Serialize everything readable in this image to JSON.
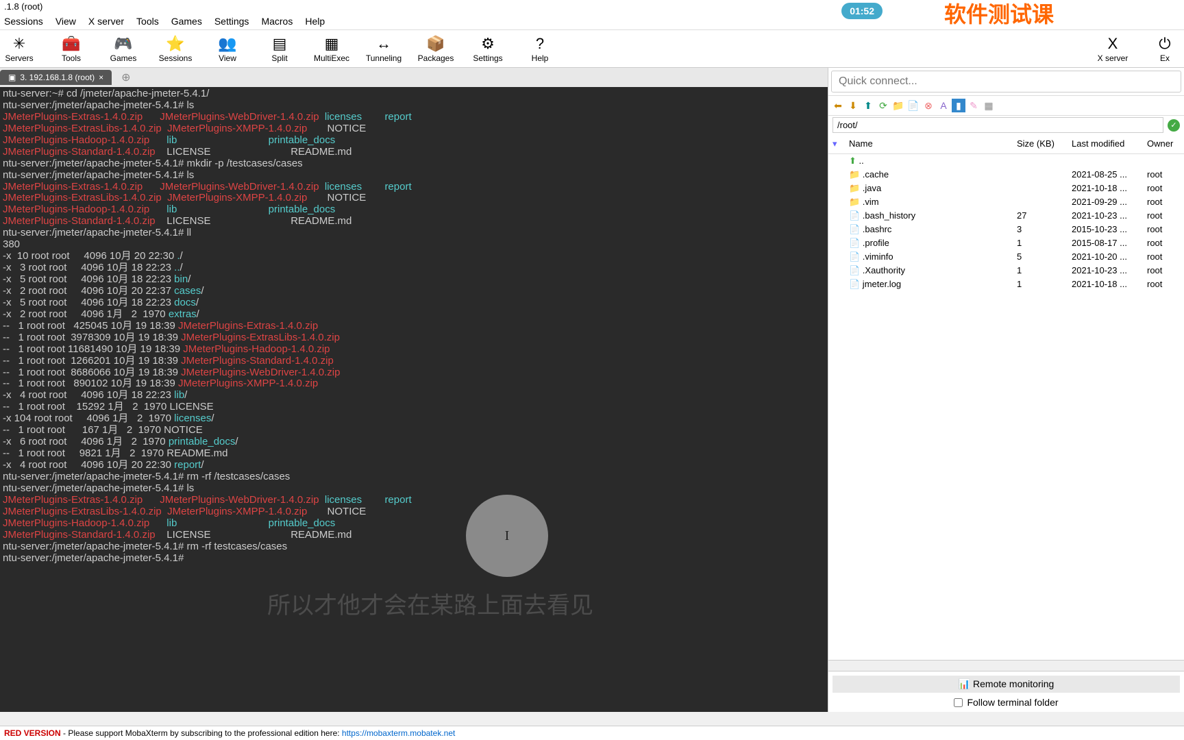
{
  "window": {
    "title": ".1.8 (root)"
  },
  "menu": [
    "Sessions",
    "View",
    "X server",
    "Tools",
    "Games",
    "Settings",
    "Macros",
    "Help"
  ],
  "toolbar": {
    "items": [
      {
        "label": "Servers",
        "icon": "✳"
      },
      {
        "label": "Tools",
        "icon": "🧰"
      },
      {
        "label": "Games",
        "icon": "🎮"
      },
      {
        "label": "Sessions",
        "icon": "⭐"
      },
      {
        "label": "View",
        "icon": "👥"
      },
      {
        "label": "Split",
        "icon": "▤"
      },
      {
        "label": "MultiExec",
        "icon": "▦"
      },
      {
        "label": "Tunneling",
        "icon": "↔"
      },
      {
        "label": "Packages",
        "icon": "📦"
      },
      {
        "label": "Settings",
        "icon": "⚙"
      },
      {
        "label": "Help",
        "icon": "?"
      }
    ],
    "right": [
      {
        "label": "X server",
        "icon": "X"
      },
      {
        "label": "Ex",
        "icon": "⏻"
      }
    ]
  },
  "tab": {
    "label": "3. 192.168.1.8 (root)"
  },
  "quick_connect": {
    "placeholder": "Quick connect..."
  },
  "path": "/root/",
  "file_columns": {
    "name": "Name",
    "size": "Size (KB)",
    "modified": "Last modified",
    "owner": "Owner"
  },
  "files": [
    {
      "name": "..",
      "size": "",
      "date": "",
      "owner": "",
      "type": "up"
    },
    {
      "name": ".cache",
      "size": "",
      "date": "2021-08-25 ...",
      "owner": "root",
      "type": "folder"
    },
    {
      "name": ".java",
      "size": "",
      "date": "2021-10-18 ...",
      "owner": "root",
      "type": "folder"
    },
    {
      "name": ".vim",
      "size": "",
      "date": "2021-09-29 ...",
      "owner": "root",
      "type": "folder"
    },
    {
      "name": ".bash_history",
      "size": "27",
      "date": "2021-10-23 ...",
      "owner": "root",
      "type": "file"
    },
    {
      "name": ".bashrc",
      "size": "3",
      "date": "2015-10-23 ...",
      "owner": "root",
      "type": "file"
    },
    {
      "name": ".profile",
      "size": "1",
      "date": "2015-08-17 ...",
      "owner": "root",
      "type": "file"
    },
    {
      "name": ".viminfo",
      "size": "5",
      "date": "2021-10-20 ...",
      "owner": "root",
      "type": "file"
    },
    {
      "name": ".Xauthority",
      "size": "1",
      "date": "2021-10-23 ...",
      "owner": "root",
      "type": "file"
    },
    {
      "name": "jmeter.log",
      "size": "1",
      "date": "2021-10-18 ...",
      "owner": "root",
      "type": "file"
    }
  ],
  "remote_monitoring": "Remote monitoring",
  "follow_terminal": "Follow terminal folder",
  "statusbar": {
    "prefix": "RED VERSION",
    "text": "  -  Please support MobaXterm by subscribing to the professional edition here:  ",
    "link": "https://mobaxterm.mobatek.net"
  },
  "timer": "01:52",
  "watermark": "软件测试课",
  "overlay": "所以才他才会在某路上面去看见",
  "terminal_lines": [
    [
      {
        "c": "white",
        "t": "ntu-server:~# cd /jmeter/apache-jmeter-5.4.1/"
      }
    ],
    [
      {
        "c": "white",
        "t": "ntu-server:/jmeter/apache-jmeter-5.4.1# ls"
      }
    ],
    [
      {
        "c": "red",
        "t": "JMeterPlugins-Extras-1.4.0.zip      "
      },
      {
        "c": "red",
        "t": "JMeterPlugins-WebDriver-1.4.0.zip  "
      },
      {
        "c": "cyan",
        "t": "licenses        "
      },
      {
        "c": "cyan",
        "t": "report"
      }
    ],
    [
      {
        "c": "red",
        "t": "JMeterPlugins-ExtrasLibs-1.4.0.zip  "
      },
      {
        "c": "red",
        "t": "JMeterPlugins-XMPP-1.4.0.zip       "
      },
      {
        "c": "white",
        "t": "NOTICE"
      }
    ],
    [
      {
        "c": "red",
        "t": "JMeterPlugins-Hadoop-1.4.0.zip      "
      },
      {
        "c": "cyan",
        "t": "lib                                "
      },
      {
        "c": "cyan",
        "t": "printable_docs"
      }
    ],
    [
      {
        "c": "red",
        "t": "JMeterPlugins-Standard-1.4.0.zip    "
      },
      {
        "c": "white",
        "t": "LICENSE                            "
      },
      {
        "c": "white",
        "t": "README.md"
      }
    ],
    [
      {
        "c": "white",
        "t": "ntu-server:/jmeter/apache-jmeter-5.4.1# mkdir -p /testcases/cases"
      }
    ],
    [
      {
        "c": "white",
        "t": "ntu-server:/jmeter/apache-jmeter-5.4.1# ls"
      }
    ],
    [
      {
        "c": "red",
        "t": "JMeterPlugins-Extras-1.4.0.zip      "
      },
      {
        "c": "red",
        "t": "JMeterPlugins-WebDriver-1.4.0.zip  "
      },
      {
        "c": "cyan",
        "t": "licenses        "
      },
      {
        "c": "cyan",
        "t": "report"
      }
    ],
    [
      {
        "c": "red",
        "t": "JMeterPlugins-ExtrasLibs-1.4.0.zip  "
      },
      {
        "c": "red",
        "t": "JMeterPlugins-XMPP-1.4.0.zip       "
      },
      {
        "c": "white",
        "t": "NOTICE"
      }
    ],
    [
      {
        "c": "red",
        "t": "JMeterPlugins-Hadoop-1.4.0.zip      "
      },
      {
        "c": "cyan",
        "t": "lib                                "
      },
      {
        "c": "cyan",
        "t": "printable_docs"
      }
    ],
    [
      {
        "c": "red",
        "t": "JMeterPlugins-Standard-1.4.0.zip    "
      },
      {
        "c": "white",
        "t": "LICENSE                            "
      },
      {
        "c": "white",
        "t": "README.md"
      }
    ],
    [
      {
        "c": "white",
        "t": "ntu-server:/jmeter/apache-jmeter-5.4.1# ll"
      }
    ],
    [
      {
        "c": "white",
        "t": "380"
      }
    ],
    [
      {
        "c": "white",
        "t": "-x  10 root root     4096 10月 20 22:30 "
      },
      {
        "c": "cyan",
        "t": "."
      },
      {
        "c": "white",
        "t": "/"
      }
    ],
    [
      {
        "c": "white",
        "t": "-x   3 root root     4096 10月 18 22:23 "
      },
      {
        "c": "cyan",
        "t": ".."
      },
      {
        "c": "white",
        "t": "/"
      }
    ],
    [
      {
        "c": "white",
        "t": "-x   5 root root     4096 10月 18 22:23 "
      },
      {
        "c": "cyan",
        "t": "bin"
      },
      {
        "c": "white",
        "t": "/"
      }
    ],
    [
      {
        "c": "white",
        "t": "-x   2 root root     4096 10月 20 22:37 "
      },
      {
        "c": "cyan",
        "t": "cases"
      },
      {
        "c": "white",
        "t": "/"
      }
    ],
    [
      {
        "c": "white",
        "t": "-x   5 root root     4096 10月 18 22:23 "
      },
      {
        "c": "cyan",
        "t": "docs"
      },
      {
        "c": "white",
        "t": "/"
      }
    ],
    [
      {
        "c": "white",
        "t": "-x   2 root root     4096 1月   2  1970 "
      },
      {
        "c": "cyan",
        "t": "extras"
      },
      {
        "c": "white",
        "t": "/"
      }
    ],
    [
      {
        "c": "white",
        "t": "--   1 root root   425045 10月 19 18:39 "
      },
      {
        "c": "red",
        "t": "JMeterPlugins-Extras-1.4.0.zip"
      }
    ],
    [
      {
        "c": "white",
        "t": "--   1 root root  3978309 10月 19 18:39 "
      },
      {
        "c": "red",
        "t": "JMeterPlugins-ExtrasLibs-1.4.0.zip"
      }
    ],
    [
      {
        "c": "white",
        "t": "--   1 root root 11681490 10月 19 18:39 "
      },
      {
        "c": "red",
        "t": "JMeterPlugins-Hadoop-1.4.0.zip"
      }
    ],
    [
      {
        "c": "white",
        "t": "--   1 root root  1266201 10月 19 18:39 "
      },
      {
        "c": "red",
        "t": "JMeterPlugins-Standard-1.4.0.zip"
      }
    ],
    [
      {
        "c": "white",
        "t": "--   1 root root  8686066 10月 19 18:39 "
      },
      {
        "c": "red",
        "t": "JMeterPlugins-WebDriver-1.4.0.zip"
      }
    ],
    [
      {
        "c": "white",
        "t": "--   1 root root   890102 10月 19 18:39 "
      },
      {
        "c": "red",
        "t": "JMeterPlugins-XMPP-1.4.0.zip"
      }
    ],
    [
      {
        "c": "white",
        "t": "-x   4 root root     4096 10月 18 22:23 "
      },
      {
        "c": "cyan",
        "t": "lib"
      },
      {
        "c": "white",
        "t": "/"
      }
    ],
    [
      {
        "c": "white",
        "t": "--   1 root root    15292 1月   2  1970 LICENSE"
      }
    ],
    [
      {
        "c": "white",
        "t": "-x 104 root root     4096 1月   2  1970 "
      },
      {
        "c": "cyan",
        "t": "licenses"
      },
      {
        "c": "white",
        "t": "/"
      }
    ],
    [
      {
        "c": "white",
        "t": "--   1 root root      167 1月   2  1970 NOTICE"
      }
    ],
    [
      {
        "c": "white",
        "t": "-x   6 root root     4096 1月   2  1970 "
      },
      {
        "c": "cyan",
        "t": "printable_docs"
      },
      {
        "c": "white",
        "t": "/"
      }
    ],
    [
      {
        "c": "white",
        "t": "--   1 root root     9821 1月   2  1970 README.md"
      }
    ],
    [
      {
        "c": "white",
        "t": "-x   4 root root     4096 10月 20 22:30 "
      },
      {
        "c": "cyan",
        "t": "report"
      },
      {
        "c": "white",
        "t": "/"
      }
    ],
    [
      {
        "c": "white",
        "t": "ntu-server:/jmeter/apache-jmeter-5.4.1# rm -rf /testcases/cases"
      }
    ],
    [
      {
        "c": "white",
        "t": "ntu-server:/jmeter/apache-jmeter-5.4.1# ls"
      }
    ],
    [
      {
        "c": "red",
        "t": "JMeterPlugins-Extras-1.4.0.zip      "
      },
      {
        "c": "red",
        "t": "JMeterPlugins-WebDriver-1.4.0.zip  "
      },
      {
        "c": "cyan",
        "t": "licenses        "
      },
      {
        "c": "cyan",
        "t": "report"
      }
    ],
    [
      {
        "c": "red",
        "t": "JMeterPlugins-ExtrasLibs-1.4.0.zip  "
      },
      {
        "c": "red",
        "t": "JMeterPlugins-XMPP-1.4.0.zip       "
      },
      {
        "c": "white",
        "t": "NOTICE"
      }
    ],
    [
      {
        "c": "red",
        "t": "JMeterPlugins-Hadoop-1.4.0.zip      "
      },
      {
        "c": "cyan",
        "t": "lib                                "
      },
      {
        "c": "cyan",
        "t": "printable_docs"
      }
    ],
    [
      {
        "c": "red",
        "t": "JMeterPlugins-Standard-1.4.0.zip    "
      },
      {
        "c": "white",
        "t": "LICENSE                            "
      },
      {
        "c": "white",
        "t": "README.md"
      }
    ],
    [
      {
        "c": "white",
        "t": "ntu-server:/jmeter/apache-jmeter-5.4.1# rm -rf testcases/cases"
      }
    ],
    [
      {
        "c": "white",
        "t": "ntu-server:/jmeter/apache-jmeter-5.4.1# "
      }
    ]
  ]
}
